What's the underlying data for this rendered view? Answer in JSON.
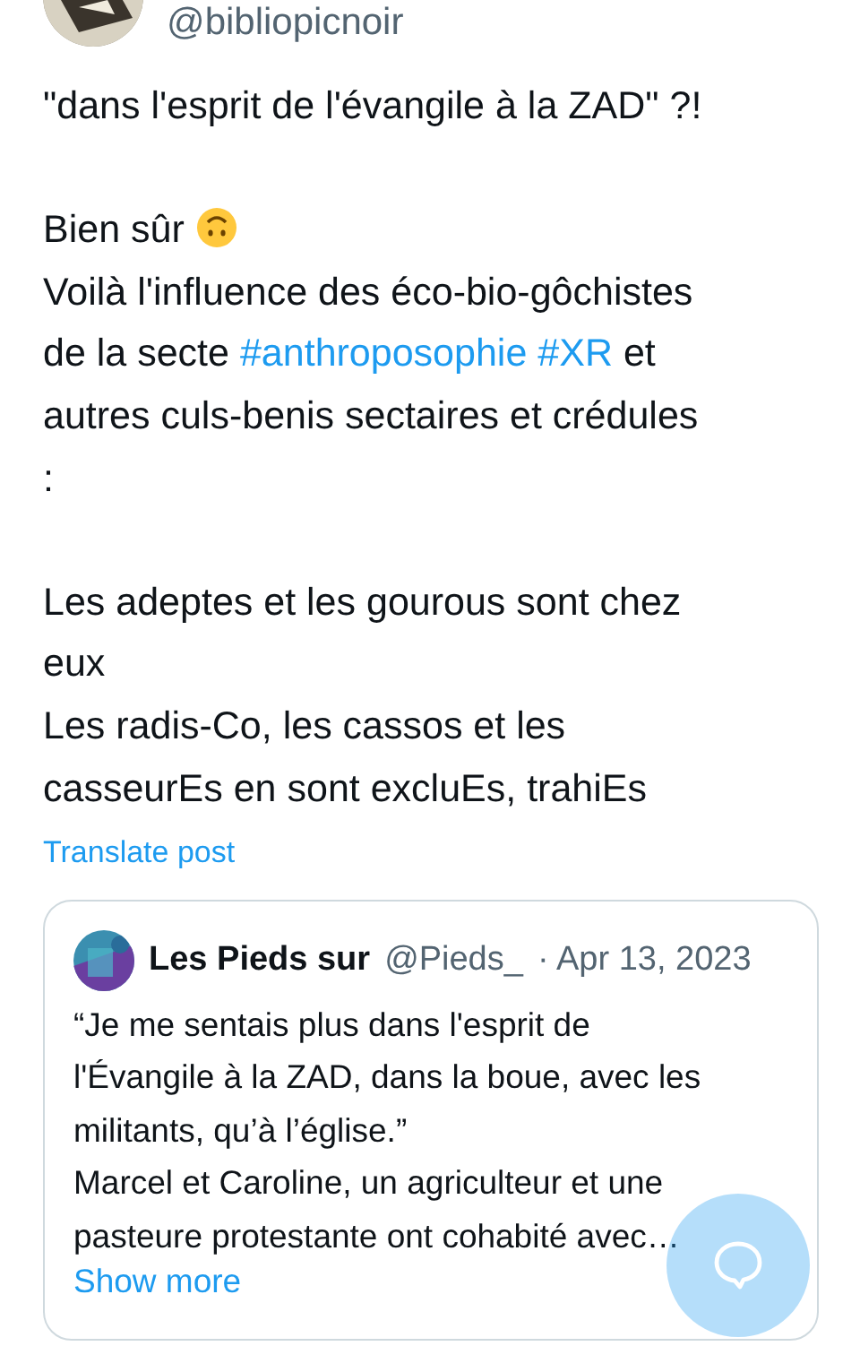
{
  "author": {
    "handle": "@bibliopicnoir"
  },
  "post": {
    "paragraphs": [
      [
        [
          {
            "kind": "text",
            "text": "\"dans l'esprit de l'évangile à la ZAD\" ?!"
          }
        ]
      ],
      [
        [
          {
            "kind": "text",
            "text": "Bien sûr "
          },
          {
            "kind": "emoji"
          }
        ],
        [
          {
            "kind": "text",
            "text": "Voilà l'influence des éco-bio-gôchistes"
          }
        ],
        [
          {
            "kind": "text",
            "text": "de la secte "
          },
          {
            "kind": "hashtag",
            "text": "#anthroposophie"
          },
          {
            "kind": "space"
          },
          {
            "kind": "hashtag",
            "text": "#XR"
          },
          {
            "kind": "text",
            "text": " et"
          }
        ],
        [
          {
            "kind": "text",
            "text": "autres culs-benis sectaires et crédules"
          }
        ],
        [
          {
            "kind": "text",
            "text": ":"
          }
        ]
      ],
      [
        [
          {
            "kind": "text",
            "text": "Les adeptes et les gourous sont chez"
          }
        ],
        [
          {
            "kind": "text",
            "text": "eux"
          }
        ],
        [
          {
            "kind": "text",
            "text": "Les radis-Co, les cassos et les"
          }
        ],
        [
          {
            "kind": "text",
            "text": "casseurEs en sont excluEs, trahiEs"
          }
        ]
      ]
    ],
    "translate_link": "Translate post"
  },
  "quote": {
    "name": "Les Pieds sur",
    "handle": "@Pieds_",
    "date": "· Apr 13, 2023",
    "lines": [
      "“Je me sentais plus dans l'esprit de",
      "l'Évangile à la ZAD, dans la boue, avec les",
      "militants, qu’à l’église.”",
      "Marcel et Caroline, un agriculteur et une",
      "pasteure protestante ont cohabité avec…"
    ],
    "show_more": "Show more"
  }
}
